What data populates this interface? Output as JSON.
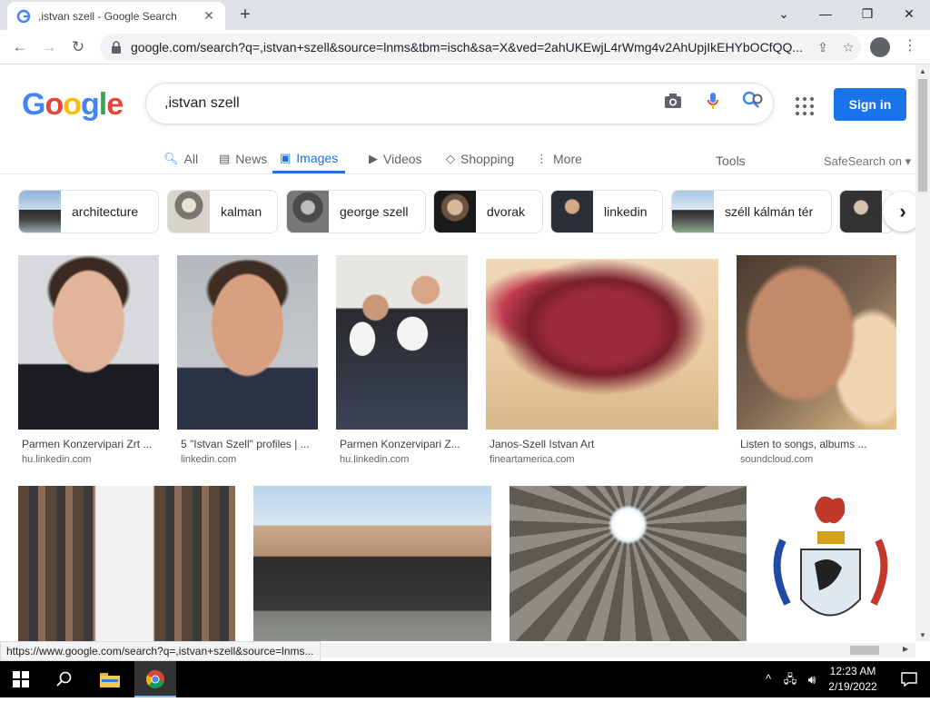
{
  "browser": {
    "tab_title": ",istvan szell - Google Search",
    "url": "google.com/search?q=,istvan+szell&source=lnms&tbm=isch&sa=X&ved=2ahUKEwjL4rWmg4v2AhUpjIkEHYbOCfQQ..."
  },
  "google": {
    "query": ",istvan szell",
    "sign_in": "Sign in",
    "tabs": [
      "All",
      "News",
      "Images",
      "Videos",
      "Shopping",
      "More"
    ],
    "tools": "Tools",
    "safesearch": "SafeSearch on"
  },
  "chips": [
    {
      "label": "architecture"
    },
    {
      "label": "kalman"
    },
    {
      "label": "george szell"
    },
    {
      "label": "dvorak"
    },
    {
      "label": "linkedin"
    },
    {
      "label": "széll kálmán tér"
    }
  ],
  "results": [
    {
      "caption": "Parmen Konzervipari Zrt ...",
      "source": "hu.linkedin.com"
    },
    {
      "caption": "5 \"Istvan Szell\" profiles | ...",
      "source": "linkedin.com"
    },
    {
      "caption": "Parmen Konzervipari Z...",
      "source": "hu.linkedin.com"
    },
    {
      "caption": "Janos-Szell Istvan Art",
      "source": "fineartamerica.com"
    },
    {
      "caption": "Listen to songs, albums ...",
      "source": "soundcloud.com"
    }
  ],
  "status_url": "https://www.google.com/search?q=,istvan+szell&source=lnms...",
  "taskbar": {
    "time": "12:23 AM",
    "date": "2/19/2022"
  }
}
